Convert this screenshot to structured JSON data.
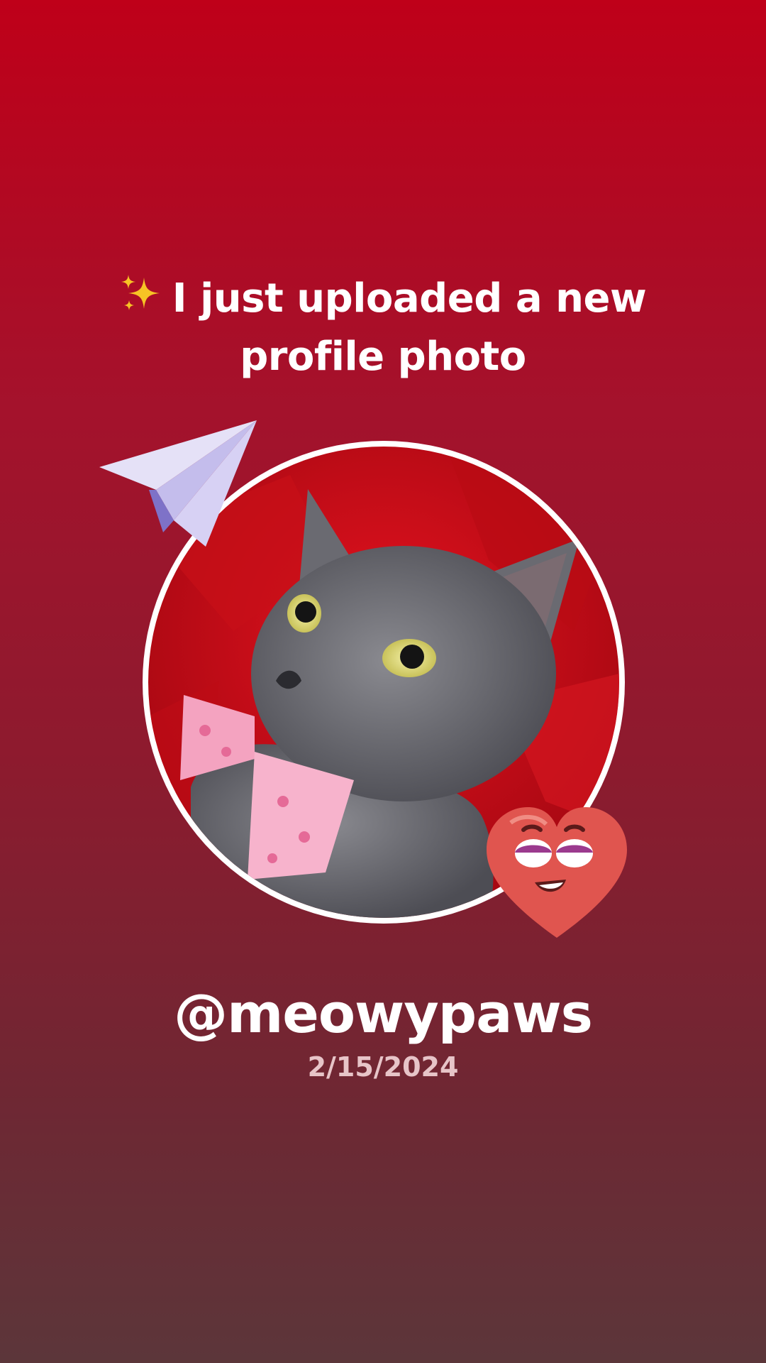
{
  "post": {
    "headline_line1": "I just uploaded a new",
    "headline_line2": "profile photo",
    "sparkle_icon": "sparkles-icon",
    "username": "@meowypaws",
    "date": "2/15/2024"
  },
  "stickers": {
    "plane": "paper-plane-icon",
    "heart": "smirking-heart-sticker"
  },
  "photo": {
    "subject": "profile-photo-gray-cat-with-pink-bow"
  },
  "colors": {
    "bg_top": "#bf0019",
    "bg_bottom": "#5c363a",
    "text": "#ffffff",
    "date": "#e7c4c8"
  }
}
